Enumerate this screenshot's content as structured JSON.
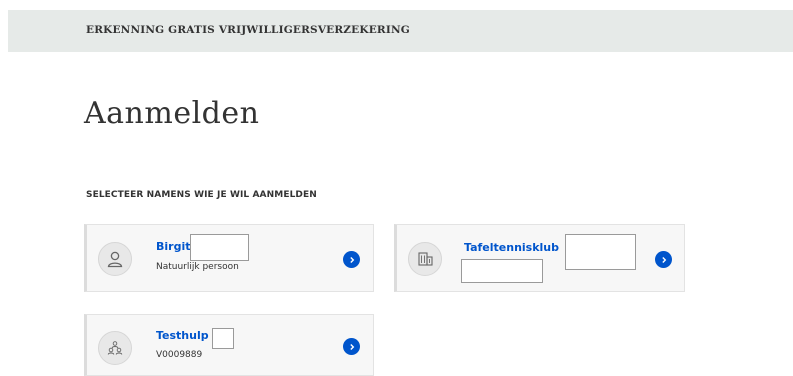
{
  "header": {
    "title": "ERKENNING GRATIS VRIJWILLIGERSVERZEKERING"
  },
  "page": {
    "title": "Aanmelden",
    "section_heading": "SELECTEER NAMENS WIE JE WIL AANMELDEN"
  },
  "accounts": [
    {
      "name": "Birgit",
      "subtitle": "Natuurlijk persoon",
      "icon": "person-icon"
    },
    {
      "name": "Tafeltennisklub",
      "subtitle": "",
      "icon": "building-icon"
    },
    {
      "name": "Testhulp",
      "subtitle": "V0009889",
      "icon": "group-icon"
    }
  ],
  "colors": {
    "accent": "#0055cc",
    "header_bg": "#e6eae8",
    "card_bg": "#f7f7f7"
  },
  "action_icon": "chevron-right-icon"
}
